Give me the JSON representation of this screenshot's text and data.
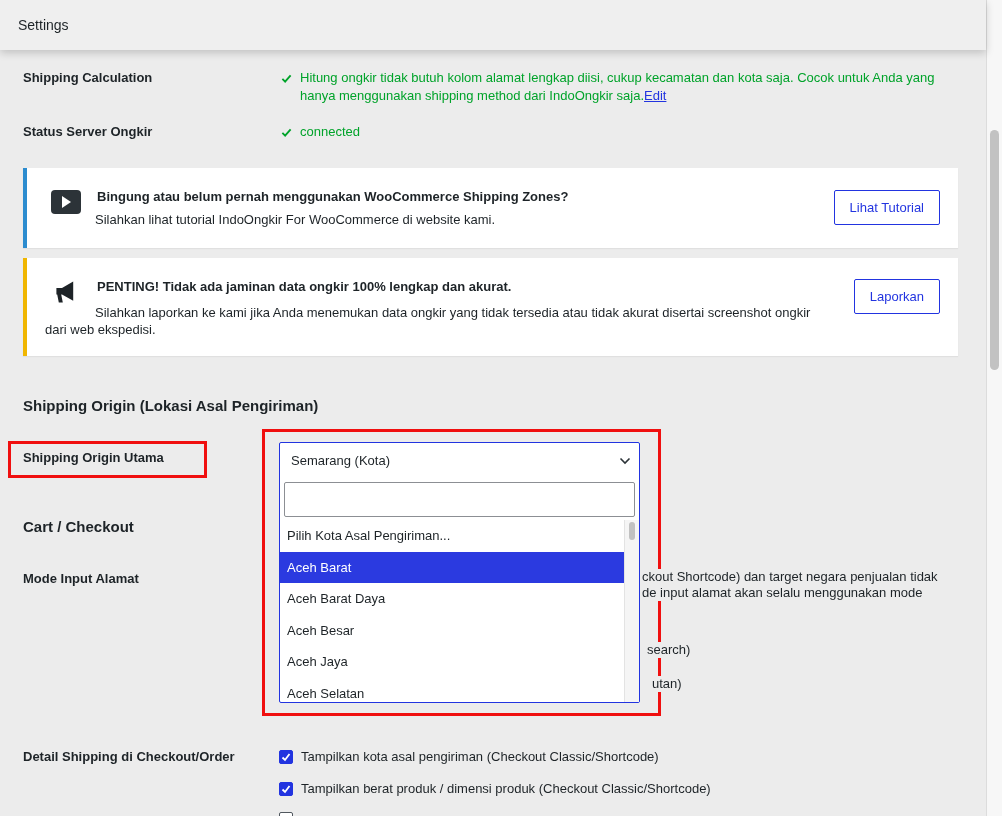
{
  "header": {
    "title": "Settings"
  },
  "settings": [
    {
      "label": "Shipping Calculation",
      "kind": "status",
      "text": "Hitung ongkir tidak butuh kolom alamat lengkap diisi, cukup kecamatan dan kota saja. Cocok untuk Anda yang hanya menggunakan shipping method dari IndoOngkir saja.",
      "link": "Edit"
    },
    {
      "label": "Status Server Ongkir",
      "kind": "status",
      "text": "connected"
    }
  ],
  "notices": [
    {
      "kind": "info",
      "title": "Bingung atau belum pernah menggunakan WooCommerce Shipping Zones?",
      "body": "Silahkan lihat tutorial IndoOngkir For WooCommerce di website kami.",
      "button": "Lihat Tutorial"
    },
    {
      "kind": "warning",
      "title": "PENTING! Tidak ada jaminan data ongkir 100% lengkap dan akurat.",
      "body": "Silahkan laporkan ke kami jika Anda menemukan data ongkir yang tidak tersedia atau tidak akurat disertai screenshot ongkir dari web ekspedisi.",
      "button": "Laporkan"
    }
  ],
  "origin_section": {
    "heading": "Shipping Origin (Lokasi Asal Pengiriman)",
    "label": "Shipping Origin Utama",
    "highlighted": true,
    "dropdown": {
      "value": "Semarang (Kota)",
      "open": true,
      "options": [
        {
          "label": "Pilih Kota Asal Pengiriman...",
          "selected": false
        },
        {
          "label": "Aceh Barat",
          "selected": true
        },
        {
          "label": "Aceh Barat Daya",
          "selected": false
        },
        {
          "label": "Aceh Besar",
          "selected": false
        },
        {
          "label": "Aceh Jaya",
          "selected": false
        },
        {
          "label": "Aceh Selatan",
          "selected": false
        }
      ]
    }
  },
  "cart_section": {
    "heading": "Cart / Checkout",
    "mode_input": {
      "label": "Mode Input Alamat",
      "visible_lines": [
        "ckout Shortcode) dan target negara penjualan tidak",
        "de input alamat akan selalu menggunakan mode",
        "search)",
        "utan)"
      ]
    },
    "detail_shipping": {
      "label": "Detail Shipping di Checkout/Order",
      "checkboxes": [
        {
          "label": "Tampilkan kota asal pengiriman (Checkout Classic/Shortcode)",
          "checked": true
        },
        {
          "label": "Tampilkan berat produk / dimensi produk (Checkout Classic/Shortcode)",
          "checked": true
        },
        {
          "checked": false
        }
      ]
    }
  }
}
